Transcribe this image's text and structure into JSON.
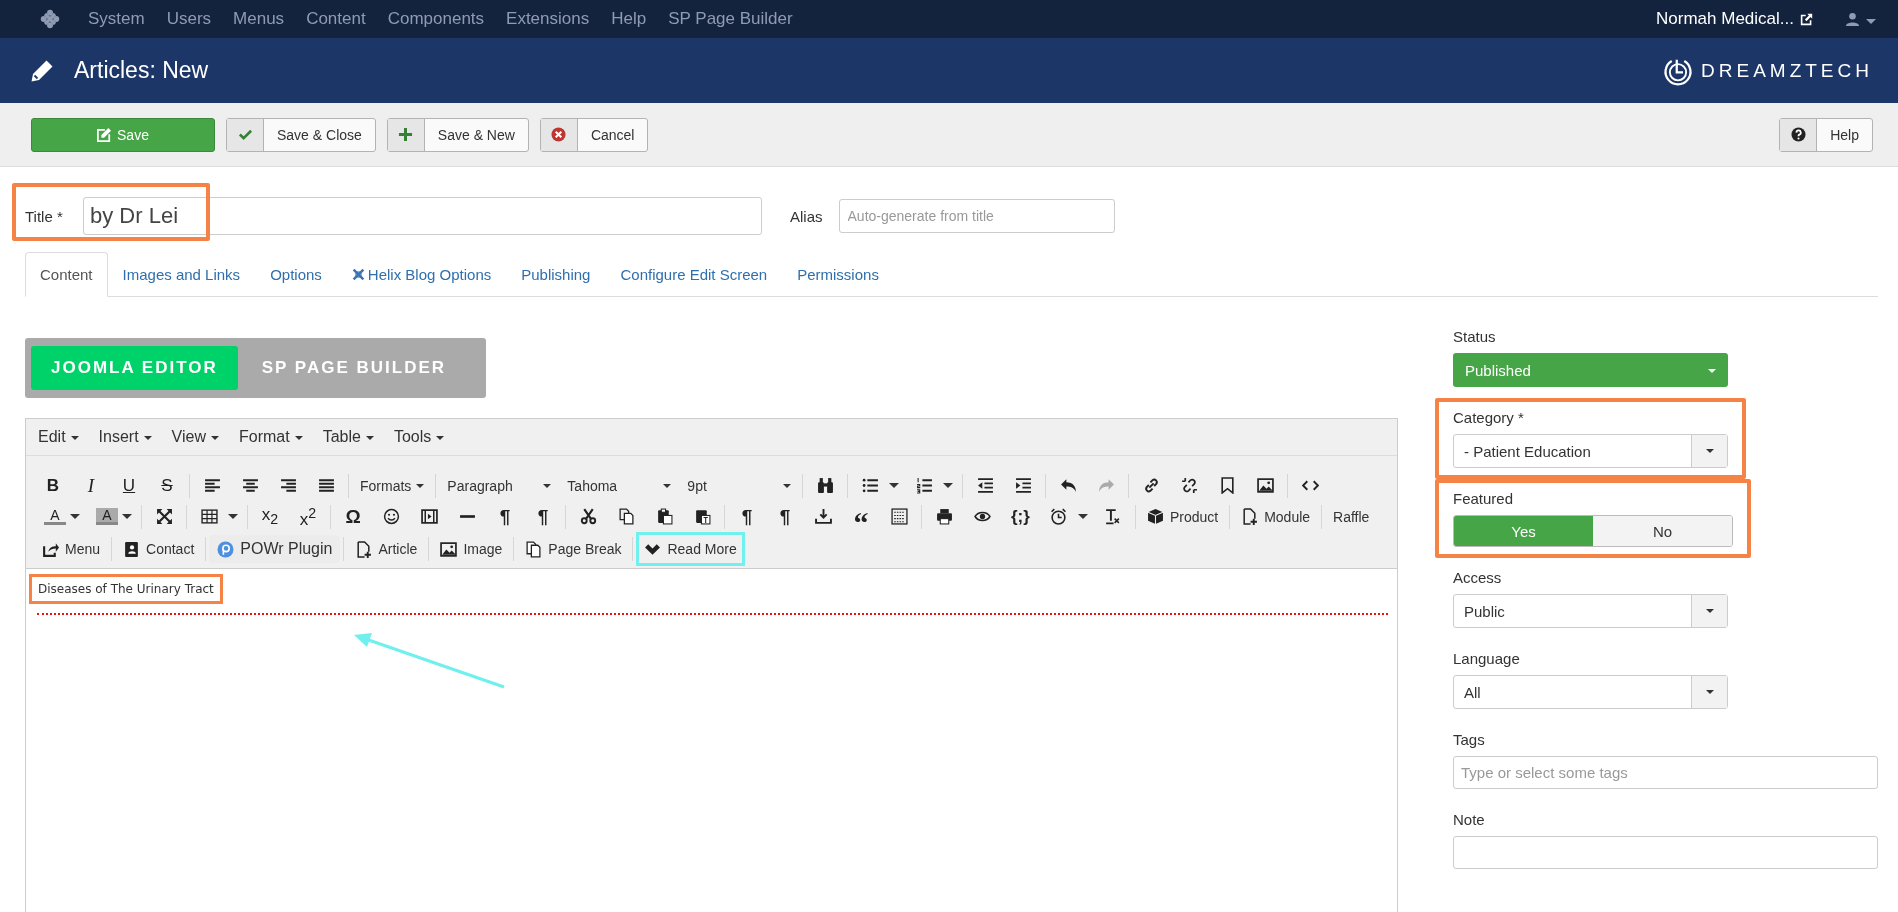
{
  "top_nav": {
    "menu": [
      "System",
      "Users",
      "Menus",
      "Content",
      "Components",
      "Extensions",
      "Help",
      "SP Page Builder"
    ],
    "site": "Normah Medical..."
  },
  "header": {
    "title": "Articles: New",
    "logo": "DREAMZTECH"
  },
  "toolbar": {
    "buttons": [
      {
        "label": "Save",
        "kind": "save"
      },
      {
        "label": "Save & Close",
        "kind": "save_close"
      },
      {
        "label": "Save & New",
        "kind": "save_new"
      },
      {
        "label": "Cancel",
        "kind": "cancel"
      }
    ],
    "help": "Help"
  },
  "title_field": {
    "label": "Title *",
    "value": "by Dr Lei",
    "highlighted": true
  },
  "alias_field": {
    "label": "Alias",
    "placeholder": "Auto-generate from title"
  },
  "tabs": [
    {
      "label": "Content",
      "selected": true,
      "kind": "plain"
    },
    {
      "label": "Images and Links",
      "selected": false,
      "kind": "plain"
    },
    {
      "label": "Options",
      "selected": false,
      "kind": "plain"
    },
    {
      "label": "Helix Blog Options",
      "selected": false,
      "kind": "icon"
    },
    {
      "label": "Publishing",
      "selected": false,
      "kind": "plain"
    },
    {
      "label": "Configure Edit Screen",
      "selected": false,
      "kind": "plain"
    },
    {
      "label": "Permissions",
      "selected": false,
      "kind": "plain"
    }
  ],
  "editor_switch": [
    {
      "label": "JOOMLA EDITOR",
      "selected": true
    },
    {
      "label": "SP PAGE BUILDER",
      "selected": false
    }
  ],
  "editor": {
    "menubar": [
      "Edit",
      "Insert",
      "View",
      "Format",
      "Table",
      "Tools"
    ],
    "glyphs": {
      "bold": "B",
      "italic": "I",
      "underline": "U",
      "strike": "S",
      "text_color": "A",
      "bg_color": "A",
      "subscript": "x$_{2}$",
      "superscript": "x$^{2}$",
      "omega": "Ω",
      "ltr": "¶",
      "rtl": "¶",
      "visualchars": "¶",
      "visualblocks": "¶",
      "quote": "“",
      "code_sample": "{;}"
    },
    "selects": [
      {
        "label": "Formats",
        "kind": "button"
      },
      {
        "label": "Paragraph",
        "kind": "select"
      },
      {
        "label": "Tahoma",
        "kind": "select"
      },
      {
        "label": "9pt",
        "kind": "select"
      }
    ],
    "redo_disabled": true,
    "row2_buttons": [
      {
        "label": "Product",
        "kind": "product"
      },
      {
        "label": "Module",
        "kind": "module"
      },
      {
        "label": "Raffle",
        "kind": "raffle"
      }
    ],
    "row3_buttons": [
      {
        "label": "Menu",
        "kind": "menu",
        "highlighted": false
      },
      {
        "label": "Contact",
        "kind": "contact",
        "highlighted": false
      },
      {
        "label": "POWr Plugin",
        "kind": "powr",
        "highlighted": false
      },
      {
        "label": "Article",
        "kind": "article",
        "highlighted": false
      },
      {
        "label": "Image",
        "kind": "image",
        "highlighted": false
      },
      {
        "label": "Page Break",
        "kind": "pagebreak",
        "highlighted": false
      },
      {
        "label": "Read More",
        "kind": "readmore",
        "highlighted": true
      }
    ],
    "content": {
      "text": "Diseases of The Urinary Tract",
      "highlighted": true,
      "read_more": true
    }
  },
  "sidebar": {
    "fields": [
      {
        "label": "Status",
        "kind": "status",
        "value": "Published",
        "highlighted": false
      },
      {
        "label": "Category *",
        "kind": "select",
        "value": "- Patient Education",
        "highlighted": true
      },
      {
        "label": "Featured",
        "kind": "toggle",
        "options": [
          {
            "label": "Yes",
            "selected": true
          },
          {
            "label": "No",
            "selected": false
          }
        ],
        "highlighted": true
      },
      {
        "label": "Access",
        "kind": "select",
        "value": "Public",
        "highlighted": false
      },
      {
        "label": "Language",
        "kind": "select",
        "value": "All",
        "highlighted": false
      },
      {
        "label": "Tags",
        "kind": "text",
        "placeholder": "Type or select some tags",
        "highlighted": false
      },
      {
        "label": "Note",
        "kind": "text",
        "highlighted": false
      }
    ]
  }
}
